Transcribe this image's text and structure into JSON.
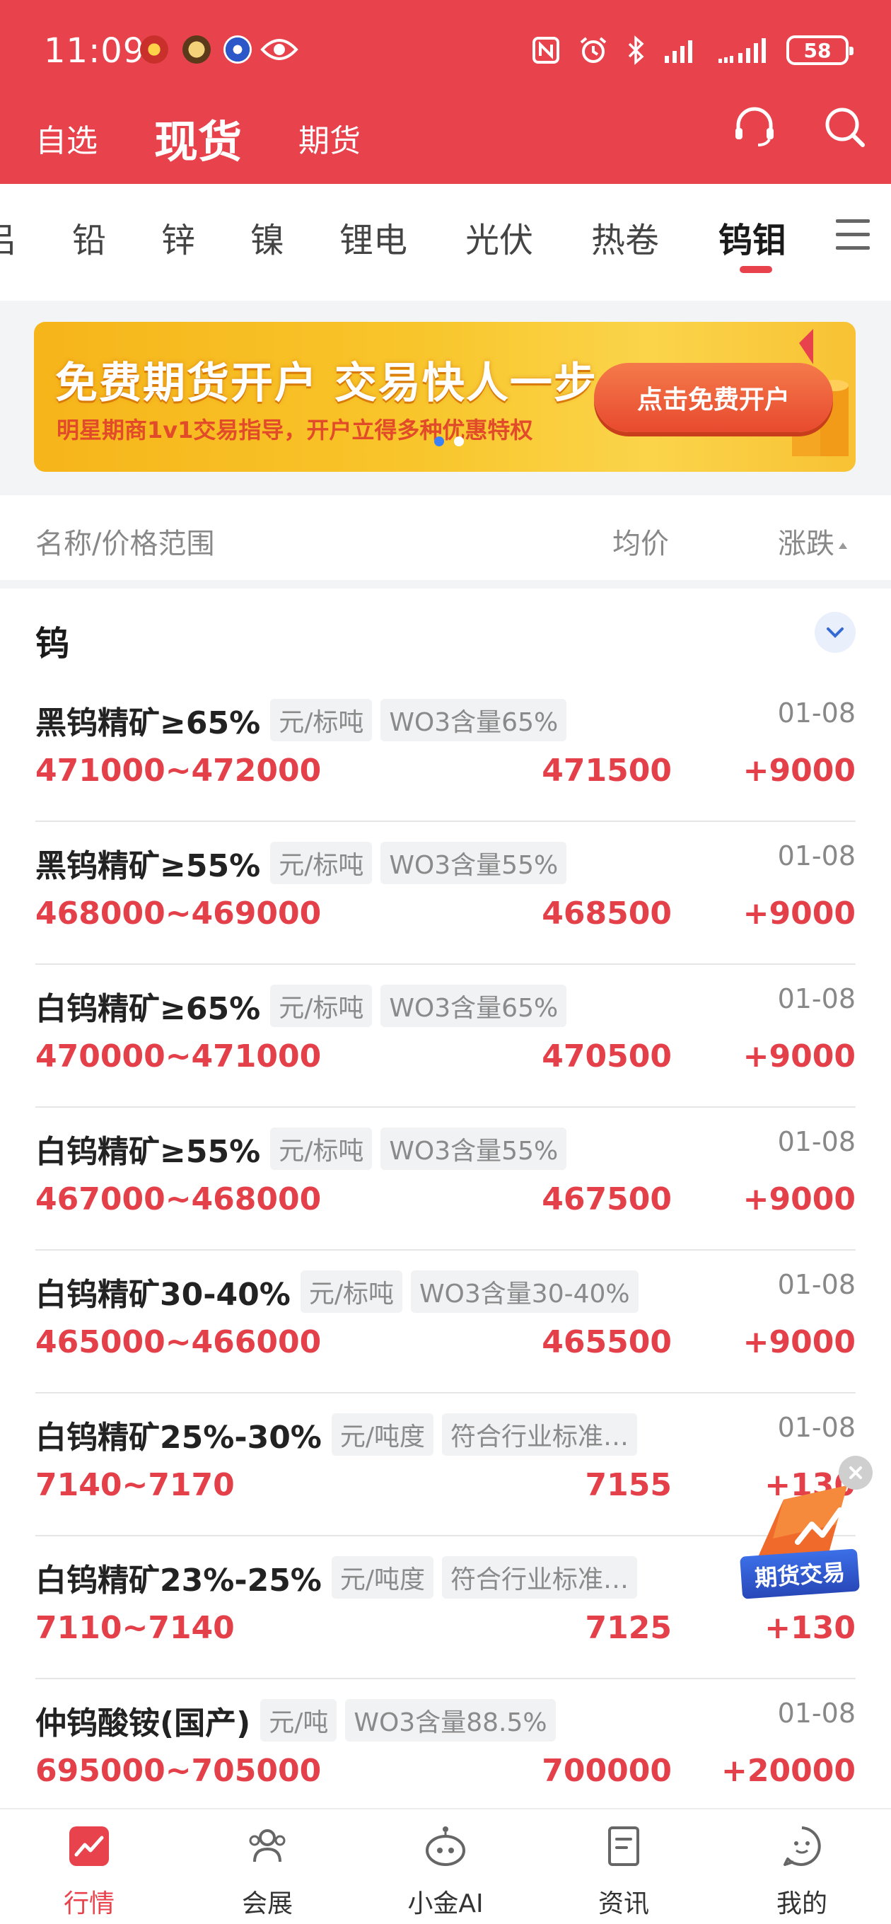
{
  "status_bar": {
    "time": "11:09",
    "battery": "58"
  },
  "header": {
    "tabs": [
      {
        "label": "自选"
      },
      {
        "label": "现货"
      },
      {
        "label": "期货"
      }
    ],
    "active_tab": "现货"
  },
  "categories": {
    "items": [
      "吕",
      "铅",
      "锌",
      "镍",
      "锂电",
      "光伏",
      "热卷",
      "钨钼"
    ],
    "active": "钨钼"
  },
  "banner": {
    "title": "免费期货开户  交易快人一步",
    "subtitle": "明星期商1v1交易指导，开户立得多种优惠特权",
    "button": "点击免费开户"
  },
  "table_header": {
    "name": "名称/价格范围",
    "avg": "均价",
    "change": "涨跌"
  },
  "section": {
    "title": "钨"
  },
  "rows": [
    {
      "name": "黑钨精矿≥65%",
      "unit": "元/标吨",
      "spec": "WO3含量65%",
      "date": "01-08",
      "range": "471000~472000",
      "avg": "471500",
      "change": "+9000"
    },
    {
      "name": "黑钨精矿≥55%",
      "unit": "元/标吨",
      "spec": "WO3含量55%",
      "date": "01-08",
      "range": "468000~469000",
      "avg": "468500",
      "change": "+9000"
    },
    {
      "name": "白钨精矿≥65%",
      "unit": "元/标吨",
      "spec": "WO3含量65%",
      "date": "01-08",
      "range": "470000~471000",
      "avg": "470500",
      "change": "+9000"
    },
    {
      "name": "白钨精矿≥55%",
      "unit": "元/标吨",
      "spec": "WO3含量55%",
      "date": "01-08",
      "range": "467000~468000",
      "avg": "467500",
      "change": "+9000"
    },
    {
      "name": "白钨精矿30-40%",
      "unit": "元/标吨",
      "spec": "WO3含量30-40%",
      "date": "01-08",
      "range": "465000~466000",
      "avg": "465500",
      "change": "+9000"
    },
    {
      "name": "白钨精矿25%-30%",
      "unit": "元/吨度",
      "spec": "符合行业标准…",
      "date": "01-08",
      "range": "7140~7170",
      "avg": "7155",
      "change": "+130"
    },
    {
      "name": "白钨精矿23%-25%",
      "unit": "元/吨度",
      "spec": "符合行业标准…",
      "date": "",
      "range": "7110~7140",
      "avg": "7125",
      "change": "+130"
    },
    {
      "name": "仲钨酸铵(国产)",
      "unit": "元/吨",
      "spec": "WO3含量88.5%",
      "date": "01-08",
      "range": "695000~705000",
      "avg": "700000",
      "change": "+20000"
    }
  ],
  "floating": {
    "label": "期货交易"
  },
  "bottom_nav": [
    {
      "label": "行情",
      "icon": "chart-icon"
    },
    {
      "label": "会展",
      "icon": "people-icon"
    },
    {
      "label": "小金AI",
      "icon": "robot-icon"
    },
    {
      "label": "资讯",
      "icon": "document-icon"
    },
    {
      "label": "我的",
      "icon": "profile-icon"
    }
  ],
  "colors": {
    "brand_red": "#e8424c",
    "price_red": "#e4404a"
  }
}
